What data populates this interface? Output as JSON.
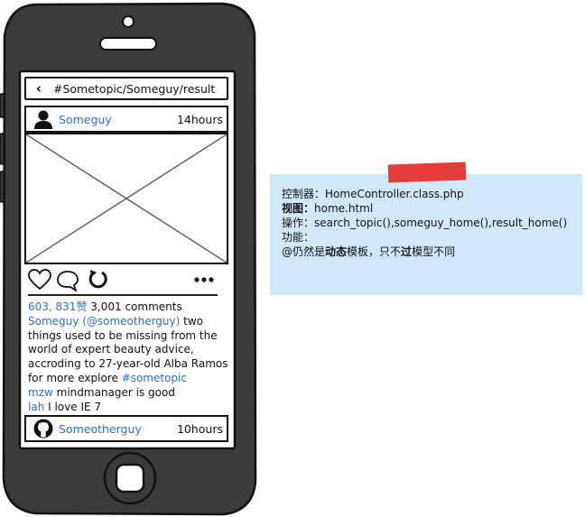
{
  "nav": {
    "back_glyph": "‹",
    "path": "#Sometopic/Someguy/result"
  },
  "post1": {
    "username": "Someguy",
    "time": "14hours"
  },
  "stats": {
    "likes": "603, 831赞",
    "comments": "3,001 comments"
  },
  "caption": {
    "author": "Someguy",
    "mention": "(@someotherguy)",
    "text_1": " two",
    "text_2": "things used to be missing from the",
    "text_3": "world of expert beauty advice,",
    "text_4": "accroding to 27-year-old Alba Ramos",
    "text_5": "for more explore ",
    "hashtag": "#sometopic"
  },
  "comments": [
    {
      "user": "mzw",
      "text": " mindmanager is good"
    },
    {
      "user": "lah",
      "text": " I love IE 7"
    }
  ],
  "post2": {
    "username": "Someotherguy",
    "time": "10hours"
  },
  "note": {
    "line1_label": "控制器：",
    "line1_value": "HomeController.class.php",
    "line2_label": "视图：",
    "line2_value": "home.html",
    "line3_label": "操作：",
    "line3_value": "search_topic(),someguy_home(),result_home()",
    "line4_label": "功能：",
    "line5_a": "@仍然是",
    "line5_b": "动态",
    "line5_c": "模板，只不",
    "line5_d": "过",
    "line5_e": "模型不同"
  },
  "icons": {
    "heart": "heart-icon",
    "comment": "comment-icon",
    "refresh": "refresh-icon",
    "more": "more-icon",
    "user": "user-avatar-icon",
    "github": "github-avatar-icon"
  },
  "colors": {
    "link": "#2f6fd0",
    "note_bg": "#cfe9fb",
    "tape": "#e5332f",
    "phone": "#3a3a3a"
  }
}
